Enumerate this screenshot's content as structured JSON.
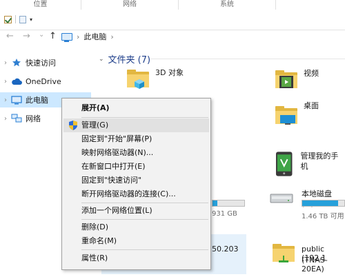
{
  "ribbon": {
    "groups": [
      "位置",
      "网络",
      "系统"
    ]
  },
  "nav": {
    "back": "←",
    "forward": "→",
    "recent": "⌄",
    "up": "↑"
  },
  "address": {
    "crumbs": [
      "此电脑"
    ],
    "separator": "›"
  },
  "sidebar": {
    "items": [
      {
        "label": "快速访问",
        "icon": "star-icon"
      },
      {
        "label": "OneDrive",
        "icon": "cloud-icon"
      },
      {
        "label": "此电脑",
        "icon": "computer-icon",
        "selected": true
      },
      {
        "label": "网络",
        "icon": "network-icon"
      }
    ]
  },
  "main": {
    "folders_header": "文件夹 (7)",
    "tiles": [
      {
        "name": "3D 对象",
        "icon": "3d-objects-folder-icon"
      },
      {
        "name": "视频",
        "icon": "video-folder-icon"
      },
      {
        "name": "桌面",
        "icon": "desktop-folder-icon"
      },
      {
        "name": "管理我的手机",
        "icon": "phone-manager-icon"
      },
      {
        "name": "本地磁盘 (F:)",
        "icon": "drive-icon",
        "size": "1.46 TB 可用",
        "fill": 0.85
      },
      {
        "name": "931 GB",
        "icon": "drive-icon",
        "fill": 0.15
      },
      {
        "name": "50.203",
        "icon": "network-location-icon"
      },
      {
        "name_line1": "public (192.1",
        "name_line2": "(TNAS-20EA)",
        "icon": "network-folder-icon"
      }
    ]
  },
  "context_menu": {
    "items": [
      {
        "label": "展开(A)",
        "bold": true
      },
      {
        "label": "管理(G)",
        "icon": "uac-shield-icon",
        "hover": true
      },
      {
        "label": "固定到\"开始\"屏幕(P)"
      },
      {
        "label": "映射网络驱动器(N)..."
      },
      {
        "label": "在新窗口中打开(E)"
      },
      {
        "label": "固定到\"快速访问\""
      },
      {
        "label": "断开网络驱动器的连接(C)..."
      },
      {
        "label": "添加一个网络位置(L)"
      },
      {
        "label": "删除(D)"
      },
      {
        "label": "重命名(M)"
      },
      {
        "label": "属性(R)"
      }
    ]
  }
}
